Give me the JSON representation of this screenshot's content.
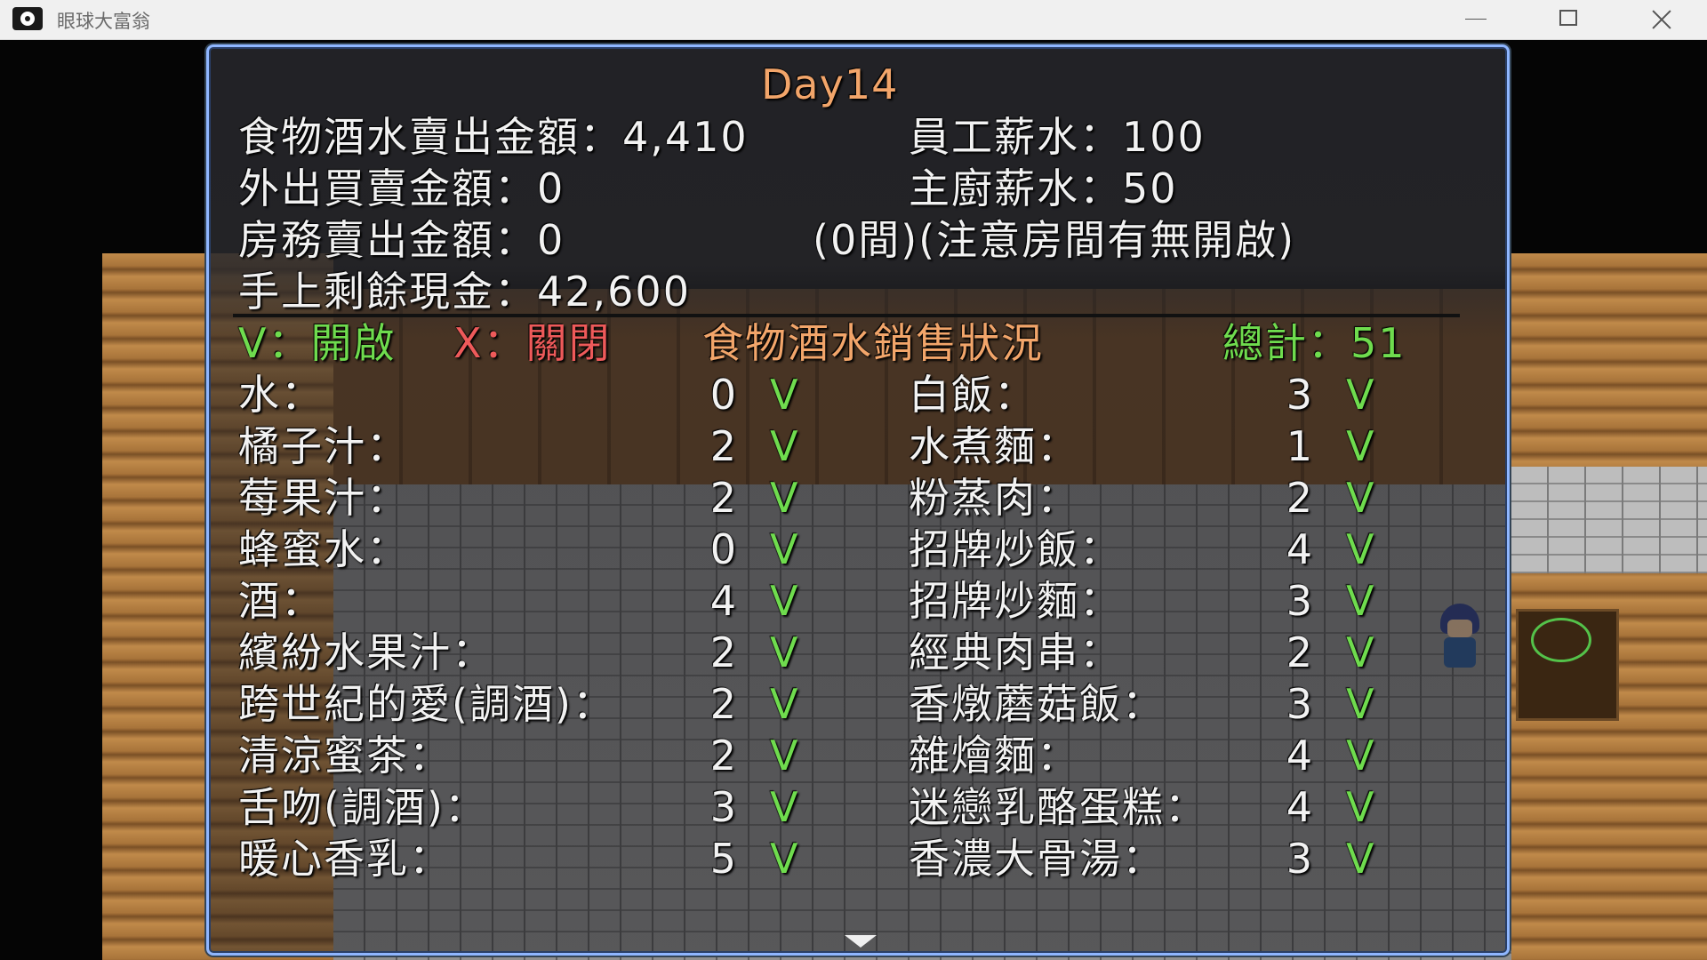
{
  "window": {
    "title": "眼球大富翁"
  },
  "report": {
    "day_title": "Day14",
    "food_sales_label": "食物酒水賣出金額：4,410",
    "staff_wage_label": "員工薪水：100",
    "outside_sales_label": "外出買賣金額：0",
    "chef_wage_label": "主廚薪水：50",
    "room_sales_label": "房務賣出金額：0",
    "room_note": "(0間)(注意房間有無開啟)",
    "cash_label": "手上剩餘現金：42,600"
  },
  "status_header": {
    "on_text": "V：開啟",
    "off_text": "X：關閉",
    "title": "食物酒水銷售狀況",
    "total": "總計：51"
  },
  "drinks": [
    {
      "name": "水：",
      "qty": "0",
      "mark": "V"
    },
    {
      "name": "橘子汁：",
      "qty": "2",
      "mark": "V"
    },
    {
      "name": "莓果汁：",
      "qty": "2",
      "mark": "V"
    },
    {
      "name": "蜂蜜水：",
      "qty": "0",
      "mark": "V"
    },
    {
      "name": "酒：",
      "qty": "4",
      "mark": "V"
    },
    {
      "name": "繽紛水果汁：",
      "qty": "2",
      "mark": "V"
    },
    {
      "name": "跨世紀的愛(調酒)：",
      "qty": "2",
      "mark": "V"
    },
    {
      "name": "清涼蜜茶：",
      "qty": "2",
      "mark": "V"
    },
    {
      "name": "舌吻(調酒)：",
      "qty": "3",
      "mark": "V"
    },
    {
      "name": "暖心香乳：",
      "qty": "5",
      "mark": "V"
    }
  ],
  "foods": [
    {
      "name": "白飯：",
      "qty": "3",
      "mark": "V"
    },
    {
      "name": "水煮麵：",
      "qty": "1",
      "mark": "V"
    },
    {
      "name": "粉蒸肉：",
      "qty": "2",
      "mark": "V"
    },
    {
      "name": "招牌炒飯：",
      "qty": "4",
      "mark": "V"
    },
    {
      "name": "招牌炒麵：",
      "qty": "3",
      "mark": "V"
    },
    {
      "name": "經典肉串：",
      "qty": "2",
      "mark": "V"
    },
    {
      "name": "香燉蘑菇飯：",
      "qty": "3",
      "mark": "V"
    },
    {
      "name": "雜燴麵：",
      "qty": "4",
      "mark": "V"
    },
    {
      "name": "迷戀乳酪蛋糕：",
      "qty": "4",
      "mark": "V"
    },
    {
      "name": "香濃大骨湯：",
      "qty": "3",
      "mark": "V"
    }
  ],
  "colors": {
    "title_orange": "#f2a56a",
    "on_green": "#6fdc4e",
    "off_red": "#ee5a5a",
    "panel_border": "#8fb6ff"
  }
}
